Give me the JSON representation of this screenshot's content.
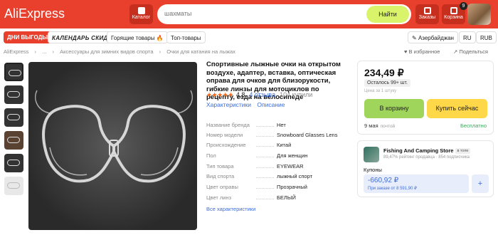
{
  "header": {
    "logo": "AliExpress",
    "catalog_label": "Каталог",
    "search_value": "шахматы",
    "search_button": "Найти",
    "orders_label": "Заказы",
    "cart_label": "Корзина",
    "cart_count": "9",
    "brand_color": "#e8402c"
  },
  "promo": {
    "deals": "ДНИ ВЫГОДЫ",
    "calendar": "КАЛЕНДАРЬ СКИДОК",
    "hot": "Горящие товары",
    "top": "Топ-товары",
    "region": "Азербайджан",
    "language": "RU",
    "currency": "RUB"
  },
  "breadcrumb": [
    "AliExpress",
    "›",
    "...",
    "›",
    "Аксессуары для зимних видов спорта",
    "›",
    "Очки для катания на лыжах"
  ],
  "actions": {
    "favorites": "♥ В избранное",
    "share": "↗ Подельться"
  },
  "product": {
    "title": "Спортивные лыжные очки на открытом воздухе, адаптер, вставка, оптическая оправа для очков для близорукости, гибкие линзы для мотоциклов по рецепту, езда на велосипеде",
    "stars": "★★★★★",
    "rating": "4,8",
    "reviews": "4 отзыва",
    "sold": "104 купили",
    "tabs": [
      "Характеристики",
      "Описание"
    ],
    "specs": [
      {
        "k": "Название бренда",
        "v": "Нет"
      },
      {
        "k": "Номер модели",
        "v": "Snowboard Glasses Lens"
      },
      {
        "k": "Происхождение",
        "v": "Китай"
      },
      {
        "k": "Пол",
        "v": "Для женщин"
      },
      {
        "k": "Тип товара",
        "v": "EYEWEAR"
      },
      {
        "k": "Вид спорта",
        "v": "лыжный спорт"
      },
      {
        "k": "Цвет оправы",
        "v": "Прозрачный"
      },
      {
        "k": "Цвет линз",
        "v": "БЕЛЫЙ"
      }
    ],
    "all_specs": "Все характеристики"
  },
  "purchase": {
    "price": "234,49 ₽",
    "stock": "Осталось 99+ шт.",
    "unit_note": "Цена за 1 штуку",
    "add_to_cart": "В корзину",
    "buy_now": "Купить сейчас",
    "delivery_date": "9 мая",
    "delivery_via": "почтой",
    "delivery_price": "Бесплатно"
  },
  "store": {
    "name": "Fishing And Camping Store",
    "badge": "в топе",
    "meta": "89,47% рейтинг продавца · 854 подписчика",
    "coupons_label": "Купоны",
    "coupon_amount": "-660,92 ₽",
    "coupon_condition": "При заказе от 8 591,90 ₽",
    "coupon_add": "+"
  }
}
